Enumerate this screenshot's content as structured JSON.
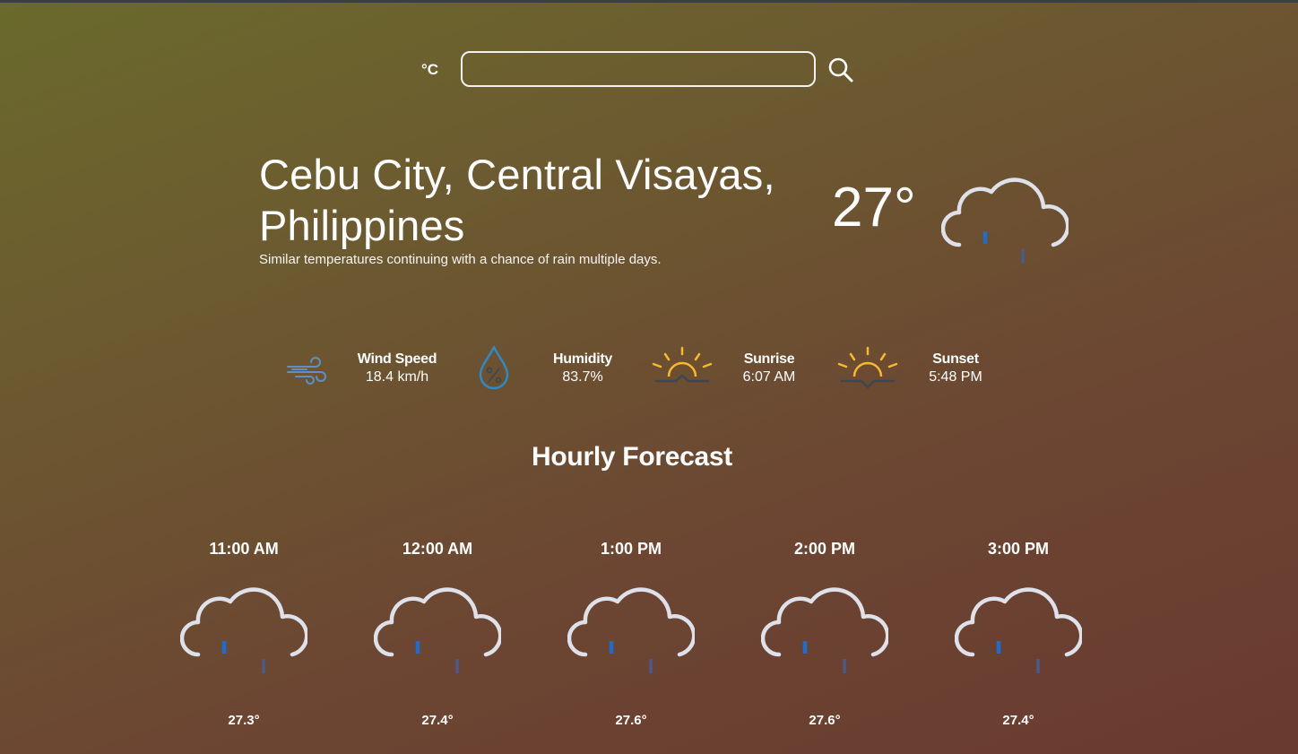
{
  "search": {
    "unit_label": "°C",
    "value": "",
    "placeholder": ""
  },
  "current": {
    "location": "Cebu City, Central Visayas, Philippines",
    "description": "Similar temperatures continuing with a chance of rain multiple days.",
    "temperature": "27°",
    "condition_icon": "rain-cloud-icon"
  },
  "stats": [
    {
      "label": "Wind Speed",
      "value": "18.4 km/h",
      "icon": "wind-icon"
    },
    {
      "label": "Humidity",
      "value": "83.7%",
      "icon": "humidity-drop-icon"
    },
    {
      "label": "Sunrise",
      "value": "6:07 AM",
      "icon": "sunrise-icon"
    },
    {
      "label": "Sunset",
      "value": "5:48 PM",
      "icon": "sunset-icon"
    }
  ],
  "hourly": {
    "title": "Hourly Forecast",
    "items": [
      {
        "time": "11:00 AM",
        "temp": "27.3°",
        "icon": "rain-cloud-icon"
      },
      {
        "time": "12:00 AM",
        "temp": "27.4°",
        "icon": "rain-cloud-icon"
      },
      {
        "time": "1:00 PM",
        "temp": "27.6°",
        "icon": "rain-cloud-icon"
      },
      {
        "time": "2:00 PM",
        "temp": "27.6°",
        "icon": "rain-cloud-icon"
      },
      {
        "time": "3:00 PM",
        "temp": "27.4°",
        "icon": "rain-cloud-icon"
      }
    ]
  },
  "colors": {
    "cloud_stroke": "#dfe1ea",
    "rain_primary": "#1f6ccf",
    "rain_secondary": "#4a5a8a",
    "sun": "#f5b82e",
    "horizon": "#3f4650",
    "wind": "#5e8fc9",
    "humidity": "#2c8ac9"
  }
}
